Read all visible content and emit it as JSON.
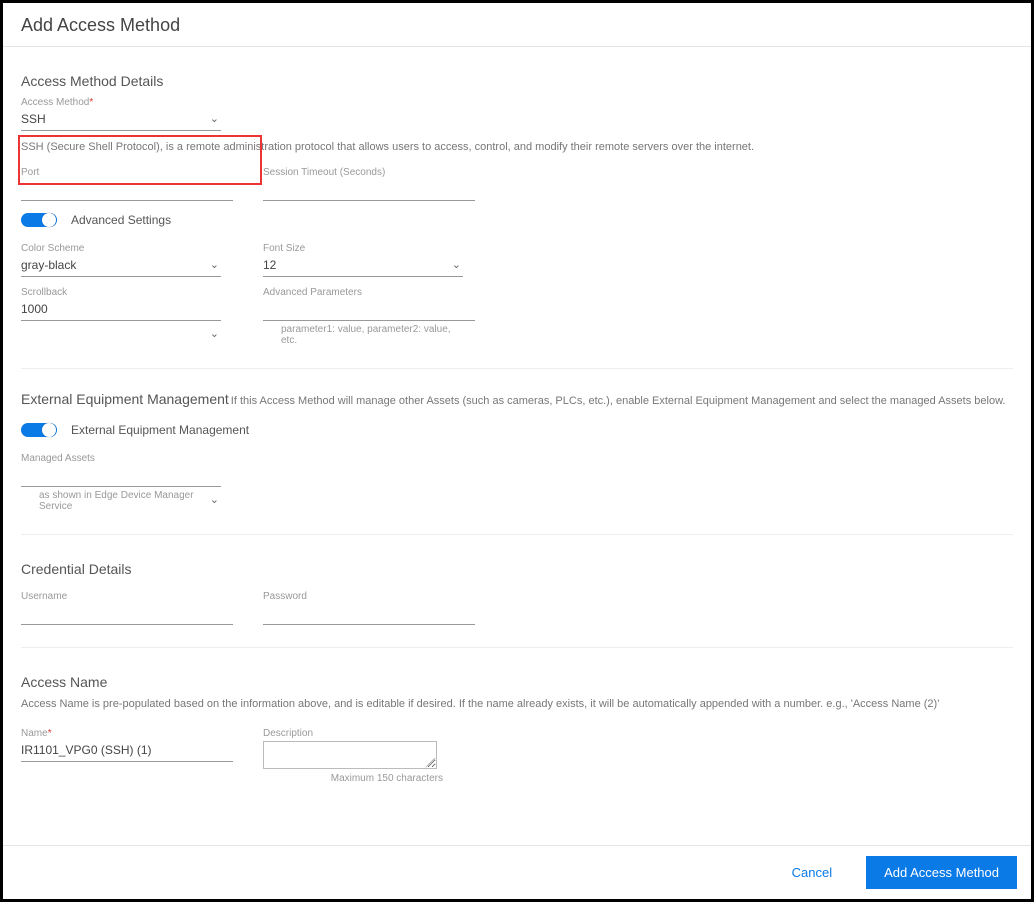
{
  "page_title": "Add Access Method",
  "sections": {
    "details": {
      "title": "Access Method Details",
      "access_method": {
        "label": "Access Method",
        "value": "SSH",
        "description": "SSH (Secure Shell Protocol), is a remote administration protocol that allows users to access, control, and modify their remote servers over the internet."
      },
      "port": {
        "label": "Port",
        "value": ""
      },
      "session_timeout": {
        "label": "Session Timeout (Seconds)",
        "value": ""
      },
      "advanced_toggle": {
        "enabled": true,
        "label": "Advanced Settings"
      },
      "color_scheme": {
        "label": "Color Scheme",
        "value": "gray-black"
      },
      "font_size": {
        "label": "Font Size",
        "value": "12"
      },
      "scrollback": {
        "label": "Scrollback",
        "value": "1000"
      },
      "advanced_params": {
        "label": "Advanced Parameters",
        "value": "",
        "hint": "parameter1: value, parameter2: value, etc."
      }
    },
    "external": {
      "title": "External Equipment Management",
      "note": "If this Access Method will manage other Assets (such as cameras, PLCs, etc.), enable External Equipment Management and select the managed Assets below.",
      "toggle": {
        "enabled": true,
        "label": "External Equipment Management"
      },
      "managed_assets": {
        "label": "Managed Assets",
        "value": "",
        "hint": "as shown in Edge Device Manager Service"
      }
    },
    "credentials": {
      "title": "Credential Details",
      "username": {
        "label": "Username",
        "value": ""
      },
      "password": {
        "label": "Password",
        "value": ""
      }
    },
    "access_name": {
      "title": "Access Name",
      "note": "Access Name is pre-populated based on the information above, and is editable if desired. If the name already exists, it will be automatically appended with a number. e.g., 'Access Name (2)'",
      "name": {
        "label": "Name",
        "value": "IR1101_VPG0 (SSH) (1)"
      },
      "description": {
        "label": "Description",
        "value": "",
        "char_hint": "Maximum 150 characters"
      }
    }
  },
  "footer": {
    "cancel": "Cancel",
    "submit": "Add Access Method"
  }
}
